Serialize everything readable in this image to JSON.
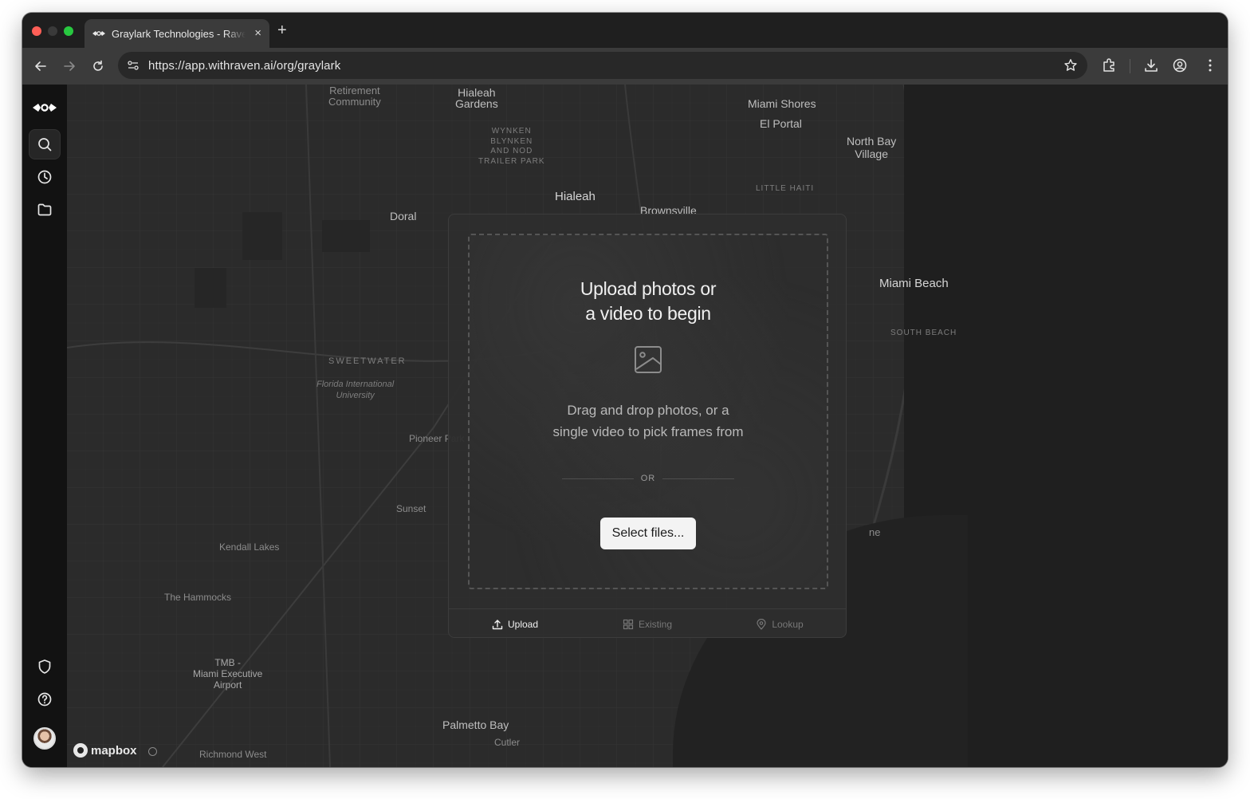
{
  "browser": {
    "tab_title": "Graylark Technologies - Raven",
    "tab_close": "×",
    "new_tab": "+",
    "url": "https://app.withraven.ai/org/graylark"
  },
  "map": {
    "labels": [
      {
        "text": "Retirement\nCommunity",
        "kind": "normal"
      },
      {
        "text": "Hialeah\nGardens",
        "kind": "normal"
      },
      {
        "text": "Miami Shores",
        "kind": "normal"
      },
      {
        "text": "El Portal",
        "kind": "normal"
      },
      {
        "text": "WYNKEN\nBLYNKEN\nAND NOD\nTRAILER PARK",
        "kind": "small"
      },
      {
        "text": "North Bay\nVillage",
        "kind": "normal"
      },
      {
        "text": "Hialeah",
        "kind": "big"
      },
      {
        "text": "LITTLE HAITI",
        "kind": "small"
      },
      {
        "text": "Doral",
        "kind": "normal"
      },
      {
        "text": "Brownsville",
        "kind": "normal"
      },
      {
        "text": "Miami Beach",
        "kind": "big"
      },
      {
        "text": "SOUTH BEACH",
        "kind": "small"
      },
      {
        "text": "SWEETWATER",
        "kind": "small"
      },
      {
        "text": "Florida International\nUniversity",
        "kind": "ital"
      },
      {
        "text": "Pioneer Park",
        "kind": "normal"
      },
      {
        "text": "Sunset",
        "kind": "normal"
      },
      {
        "text": "ne",
        "kind": "normal"
      },
      {
        "text": "Kendall Lakes",
        "kind": "normal"
      },
      {
        "text": "The Hammocks",
        "kind": "normal"
      },
      {
        "text": "TMB -\nMiami Executive\nAirport",
        "kind": "normal"
      },
      {
        "text": "Palmetto Bay",
        "kind": "normal"
      },
      {
        "text": "Cutler",
        "kind": "normal"
      },
      {
        "text": "Richmond West",
        "kind": "normal"
      }
    ],
    "attribution": "mapbox"
  },
  "upload": {
    "title_line1": "Upload photos or",
    "title_line2": "a video to begin",
    "subtitle_line1": "Drag and drop photos, or a",
    "subtitle_line2": "single video to pick frames from",
    "or_text": "OR",
    "select_button": "Select files..."
  },
  "tabs": [
    {
      "label": "Upload",
      "icon": "upload-icon",
      "active": true
    },
    {
      "label": "Existing",
      "icon": "grid-icon",
      "active": false
    },
    {
      "label": "Lookup",
      "icon": "map-pin-icon",
      "active": false
    }
  ],
  "sidebar": {
    "items": [
      {
        "icon": "raven-logo-icon"
      },
      {
        "icon": "search-icon",
        "active": true
      },
      {
        "icon": "clock-icon"
      },
      {
        "icon": "folder-icon"
      },
      {
        "icon": "shield-icon"
      },
      {
        "icon": "help-icon"
      },
      {
        "icon": "avatar"
      }
    ]
  }
}
